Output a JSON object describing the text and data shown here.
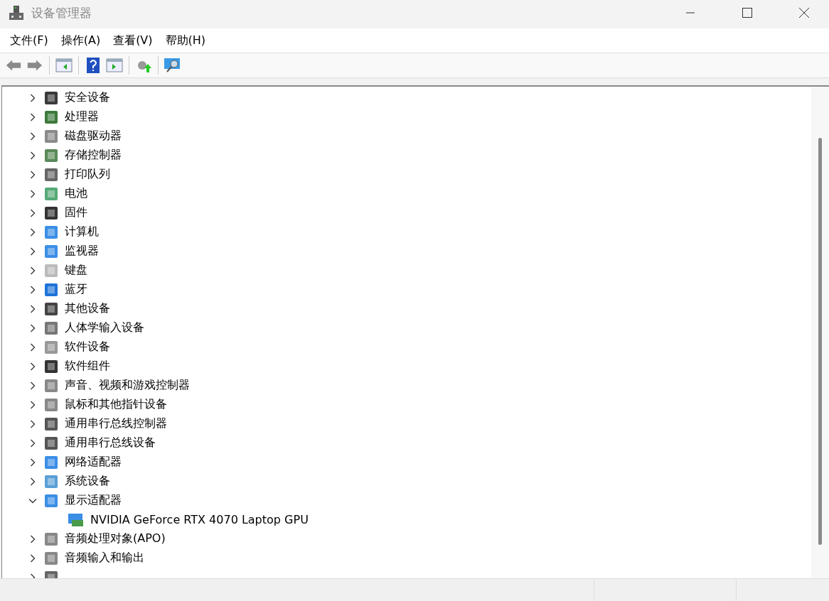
{
  "window": {
    "title": "设备管理器"
  },
  "menu": [
    "文件(F)",
    "操作(A)",
    "查看(V)",
    "帮助(H)"
  ],
  "tree": [
    {
      "label": "安全设备",
      "expanded": false
    },
    {
      "label": "处理器",
      "expanded": false
    },
    {
      "label": "磁盘驱动器",
      "expanded": false
    },
    {
      "label": "存储控制器",
      "expanded": false
    },
    {
      "label": "打印队列",
      "expanded": false
    },
    {
      "label": "电池",
      "expanded": false
    },
    {
      "label": "固件",
      "expanded": false
    },
    {
      "label": "计算机",
      "expanded": false
    },
    {
      "label": "监视器",
      "expanded": false
    },
    {
      "label": "键盘",
      "expanded": false
    },
    {
      "label": "蓝牙",
      "expanded": false
    },
    {
      "label": "其他设备",
      "expanded": false
    },
    {
      "label": "人体学输入设备",
      "expanded": false
    },
    {
      "label": "软件设备",
      "expanded": false
    },
    {
      "label": "软件组件",
      "expanded": false
    },
    {
      "label": "声音、视频和游戏控制器",
      "expanded": false
    },
    {
      "label": "鼠标和其他指针设备",
      "expanded": false
    },
    {
      "label": "通用串行总线控制器",
      "expanded": false
    },
    {
      "label": "通用串行总线设备",
      "expanded": false
    },
    {
      "label": "网络适配器",
      "expanded": false
    },
    {
      "label": "系统设备",
      "expanded": false
    },
    {
      "label": "显示适配器",
      "expanded": true,
      "children": [
        {
          "label": "NVIDIA GeForce RTX 4070 Laptop GPU"
        }
      ]
    },
    {
      "label": "音频处理对象(APO)",
      "expanded": false
    },
    {
      "label": "音频输入和输出",
      "expanded": false
    },
    {
      "expanded": false
    }
  ]
}
